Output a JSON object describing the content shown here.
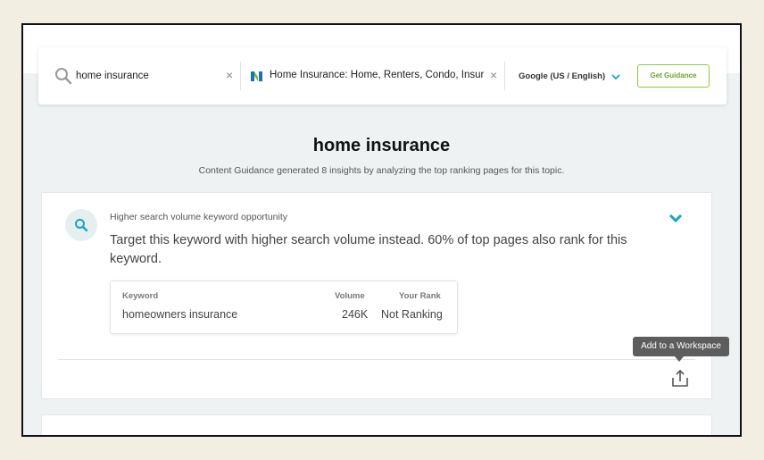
{
  "search": {
    "query": "home insurance",
    "query_placeholder": "Enter a topic",
    "clear_symbol": "×",
    "url_title": "Home Insurance: Home, Renters,  Condo, Insur...",
    "engine": "Google (US / English)",
    "guidance_button": "Get Guidance"
  },
  "page": {
    "title": "home insurance",
    "subtitle": "Content Guidance generated 8 insights by analyzing the top ranking pages for this topic."
  },
  "insight": {
    "category": "Higher search volume keyword opportunity",
    "headline": "Target this keyword with higher search volume instead. 60% of top pages also rank for this keyword.",
    "table": {
      "headers": {
        "keyword": "Keyword",
        "volume": "Volume",
        "rank": "Your Rank"
      },
      "rows": [
        {
          "keyword": "homeowners insurance",
          "volume": "246K",
          "rank": "Not Ranking"
        }
      ]
    },
    "tooltip": "Add to a Workspace"
  },
  "colors": {
    "accent_teal": "#1aa3c4",
    "guidance_green": "#8dc63f",
    "site_blue": "#1f6fb5",
    "site_green": "#7bbf3c"
  },
  "icons": {
    "search": "search-icon",
    "site": "site-favicon-icon",
    "engine_chevron": "chevron-down-icon",
    "insight_search": "search-icon",
    "collapse": "chevron-down-icon",
    "share": "share-icon"
  }
}
